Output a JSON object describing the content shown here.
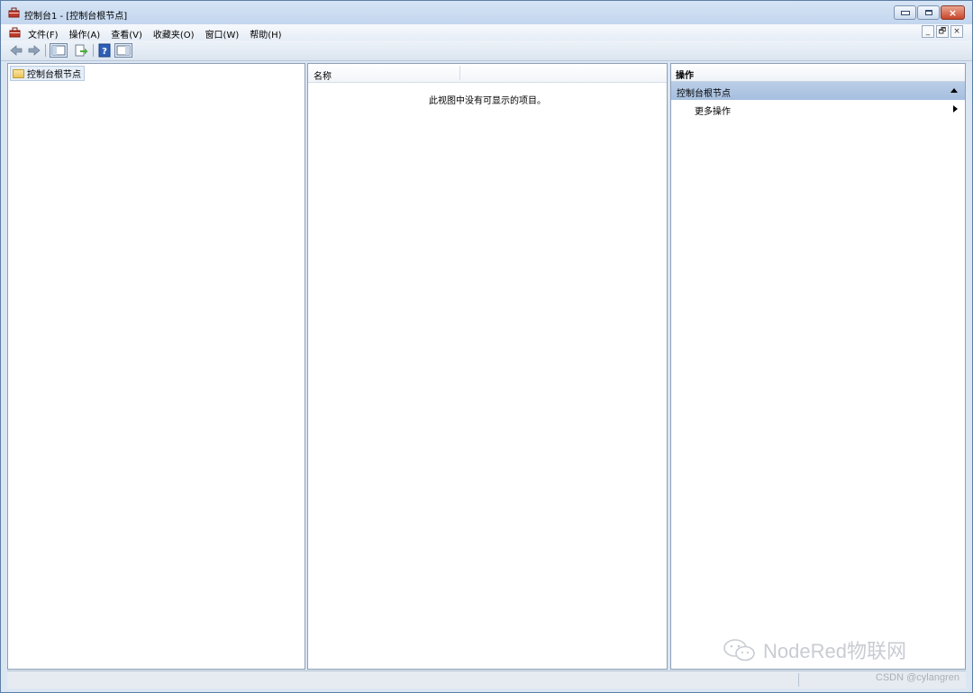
{
  "window": {
    "title": "控制台1 - [控制台根节点]",
    "app_icon": "mmc-toolbox-icon"
  },
  "menubar": {
    "items": [
      "文件(F)",
      "操作(A)",
      "查看(V)",
      "收藏夹(O)",
      "窗口(W)",
      "帮助(H)"
    ],
    "mdi_minimize": "_",
    "mdi_restore": "🗗",
    "mdi_close": "×"
  },
  "toolbar": {
    "buttons": [
      "back-arrow-icon",
      "forward-arrow-icon",
      "show-hide-console-tree-icon",
      "export-list-icon",
      "help-icon",
      "show-hide-action-pane-icon"
    ]
  },
  "tree": {
    "root_label": "控制台根节点"
  },
  "list": {
    "column_name": "名称",
    "empty_message": "此视图中没有可显示的项目。"
  },
  "actions": {
    "header": "操作",
    "group_label": "控制台根节点",
    "item_label": "更多操作"
  },
  "watermark": {
    "text": "NodeRed物联网",
    "credit": "CSDN @cylangren"
  },
  "colors": {
    "accent": "#a6bfdf",
    "close_button": "#c8452b",
    "window_frame": "#5d7ea6"
  }
}
